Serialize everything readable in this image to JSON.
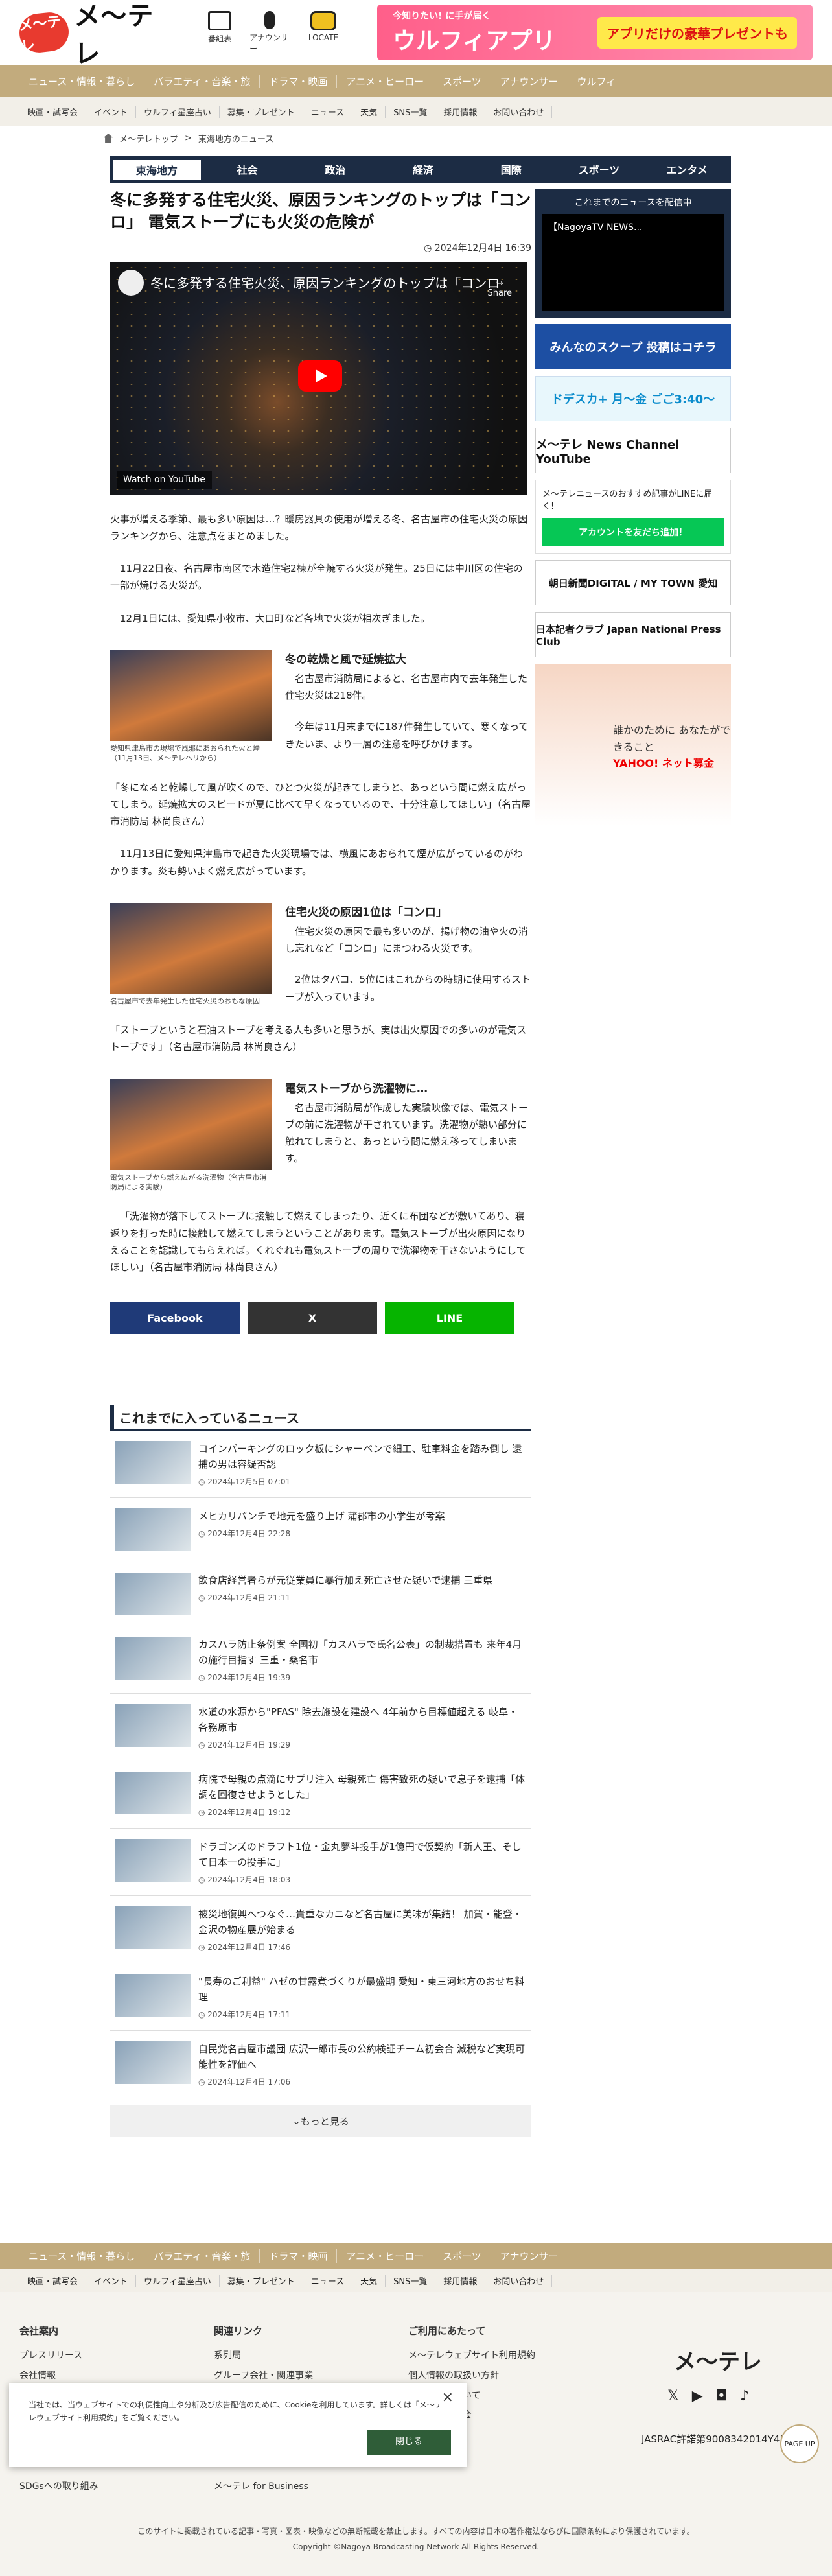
{
  "header": {
    "logo_badge": "メ〜テレ",
    "logo_text": "メ〜テレ",
    "icons": [
      "番組表",
      "アナウンサー",
      "LOCATE"
    ],
    "banner_small": "今知りたい! に手が届く",
    "banner_big": "ウルフィアプリ",
    "banner_right": "アプリだけの豪華プレゼントも"
  },
  "nav1": [
    "ニュース・情報・暮らし",
    "バラエティ・音楽・旅",
    "ドラマ・映画",
    "アニメ・ヒーロー",
    "スポーツ",
    "アナウンサー",
    "ウルフィ"
  ],
  "nav2": [
    "映画・試写会",
    "イベント",
    "ウルフィ星座占い",
    "募集・プレゼント",
    "ニュース",
    "天気",
    "SNS一覧",
    "採用情報",
    "お問い合わせ"
  ],
  "breadcrumb": [
    "メ〜テレトップ",
    "東海地方のニュース"
  ],
  "tabs": [
    "東海地方",
    "社会",
    "政治",
    "経済",
    "国際",
    "スポーツ",
    "エンタメ"
  ],
  "article": {
    "title": "冬に多発する住宅火災、原因ランキングのトップは「コンロ」 電気ストーブにも火災の危険が",
    "date": "2024年12月4日 16:39",
    "video_title": "冬に多発する住宅火災、原因ランキングのトップは「コンロ",
    "video_share": "Share",
    "video_watch": "Watch on YouTube",
    "p1": "火事が増える季節、最も多い原因は…？暖房器具の使用が増える冬、名古屋市の住宅火災の原因ランキングから、注意点をまとめました。",
    "p2": "11月22日夜、名古屋市南区で木造住宅2棟が全焼する火災が発生。25日には中川区の住宅の一部が焼ける火災が。",
    "p3": "12月1日には、愛知県小牧市、大口町など各地で火災が相次ぎました。",
    "s1_h": "冬の乾燥と風で延焼拡大",
    "s1_cap": "愛知県津島市の現場で風邪にあおられた火と煙（11月13日、メ〜テレヘリから）",
    "s1_b1": "名古屋市消防局によると、名古屋市内で去年発生した住宅火災は218件。",
    "s1_b2": "今年は11月末までに187件発生していて、寒くなってきたいま、より一層の注意を呼びかけます。",
    "s1_q": "「冬になると乾燥して風が吹くので、ひとつ火災が起きてしまうと、あっという間に燃え広がってしまう。延焼拡大のスピードが夏に比べて早くなっているので、十分注意してほしい」（名古屋市消防局 林尚良さん）",
    "s1_p": "11月13日に愛知県津島市で起きた火災現場では、横風にあおられて煙が広がっているのがわかります。炎も勢いよく燃え広がっています。",
    "s2_h": "住宅火災の原因1位は「コンロ」",
    "s2_cap": "名古屋市で去年発生した住宅火災のおもな原因",
    "s2_b1": "住宅火災の原因で最も多いのが、揚げ物の油や火の消し忘れなど「コンロ」にまつわる火災です。",
    "s2_b2": "2位はタバコ、5位にはこれからの時期に使用するストーブが入っています。",
    "s2_q": "「ストーブというと石油ストーブを考える人も多いと思うが、実は出火原因での多いのが電気ストーブです」（名古屋市消防局 林尚良さん）",
    "s3_h": "電気ストーブから洗濯物に…",
    "s3_cap": "電気ストーブから燃え広がる洗濯物（名古屋市消防局による実験）",
    "s3_b1": "名古屋市消防局が作成した実験映像では、電気ストーブの前に洗濯物が干されています。洗濯物が熱い部分に触れてしまうと、あっという間に燃え移ってしまいます。",
    "s3_q": "「洗濯物が落下してストーブに接触して燃えてしまったり、近くに布団などが敷いてあり、寝返りを打った時に接触して燃えてしまうということがあります。電気ストーブが出火原因になりえることを認識してもらえれば。くれぐれも電気ストーブの周りで洗濯物を干さないようにしてほしい」（名古屋市消防局 林尚良さん）"
  },
  "share": {
    "facebook": "Facebook",
    "x": "X",
    "line": "LINE"
  },
  "news_heading": "これまでに入っているニュース",
  "news": [
    {
      "title": "コインパーキングのロック板にシャーペンで細工、駐車料金を踏み倒し 逮捕の男は容疑否認",
      "date": "2024年12月5日 07:01"
    },
    {
      "title": "メヒカリバンチで地元を盛り上げ 蒲郡市の小学生が考案",
      "date": "2024年12月4日 22:28"
    },
    {
      "title": "飲食店経営者らが元従業員に暴行加え死亡させた疑いで逮捕 三重県",
      "date": "2024年12月4日 21:11"
    },
    {
      "title": "カスハラ防止条例案 全国初「カスハラで氏名公表」の制裁措置も 来年4月の施行目指す 三重・桑名市",
      "date": "2024年12月4日 19:39"
    },
    {
      "title": "水道の水源から\"PFAS\" 除去施設を建設へ 4年前から目標値超える 岐阜・各務原市",
      "date": "2024年12月4日 19:29"
    },
    {
      "title": "病院で母親の点滴にサプリ注入 母親死亡 傷害致死の疑いで息子を逮捕「体調を回復させようとした」",
      "date": "2024年12月4日 19:12"
    },
    {
      "title": "ドラゴンズのドラフト1位・金丸夢斗投手が1億円で仮契約「新人王、そして日本一の投手に」",
      "date": "2024年12月4日 18:03"
    },
    {
      "title": "被災地復興へつなぐ…貴重なカニなど名古屋に美味が集結！ 加賀・能登・金沢の物産展が始まる",
      "date": "2024年12月4日 17:46"
    },
    {
      "title": "\"長寿のご利益\" ハゼの甘露煮づくりが最盛期 愛知・東三河地方のおせち料理",
      "date": "2024年12月4日 17:11"
    },
    {
      "title": "自民党名古屋市議団 広沢一郎市長の公約検証チーム初会合 減税など実現可能性を評価へ",
      "date": "2024年12月4日 17:06"
    }
  ],
  "more": "もっと見る",
  "side": {
    "video_head": "これまでのニュースを配信中",
    "video_cap": "【NagoyaTV NEWS...",
    "b1": "みんなのスクープ 投稿はコチラ",
    "b2": "ドデスカ+ 月〜金 ごご3:40〜",
    "b3": "メ〜テレ News Channel YouTube",
    "line_text": "メ〜テレニュースのおすすめ記事がLINEに届く!",
    "line_btn": "アカウントを友だち追加！",
    "b4": "朝日新聞DIGITAL / MY TOWN 愛知",
    "b5": "日本記者クラブ Japan National Press Club",
    "ad_text": "誰かのために あなたができること",
    "ad_brand": "YAHOO! ネット募金"
  },
  "footer": {
    "nav1": [
      "ニュース・情報・暮らし",
      "バラエティ・音楽・旅",
      "ドラマ・映画",
      "アニメ・ヒーロー",
      "スポーツ",
      "アナウンサー"
    ],
    "nav2": [
      "映画・試写会",
      "イベント",
      "ウルフィ星座占い",
      "募集・プレゼント",
      "ニュース",
      "天気",
      "SNS一覧",
      "採用情報",
      "お問い合わせ"
    ],
    "col1_head": "会社案内",
    "col1": [
      "プレスリリース",
      "会社情報",
      "",
      "",
      "",
      "SDGsへの取り組み"
    ],
    "col2_head": "関連リンク",
    "col2": [
      "系列局",
      "グループ会社・関連事業",
      "",
      "",
      "",
      "メ〜テレ for Business"
    ],
    "col3_head": "ご利用にあたって",
    "col3": [
      "メ〜テレウェブサイト利用規約",
      "個人情報の取扱い方針",
      "基本方針について",
      "放送番組審議会",
      "お問い合わせ",
      "お問い合わせ"
    ],
    "logo": "メ〜テレ",
    "jasrac": "JASRAC許諾第9008342014Y45037号",
    "copy1": "このサイトに掲載されている記事・写真・図表・映像などの無断転載を禁止します。すべての内容は日本の著作権法ならびに国際条約により保護されています。",
    "copy2": "Copyright ©Nagoya Broadcasting Network All Rights Reserved."
  },
  "cookie": {
    "text": "当社では、当ウェブサイトでの利便性向上や分析及び広告配信のために、Cookieを利用しています。詳しくは「メ〜テレウェブサイト利用規約」をご覧ください。",
    "link": "「メ〜テレウェブサイト利用規約」",
    "ok": "閉じる"
  },
  "pagetop": "PAGE UP"
}
